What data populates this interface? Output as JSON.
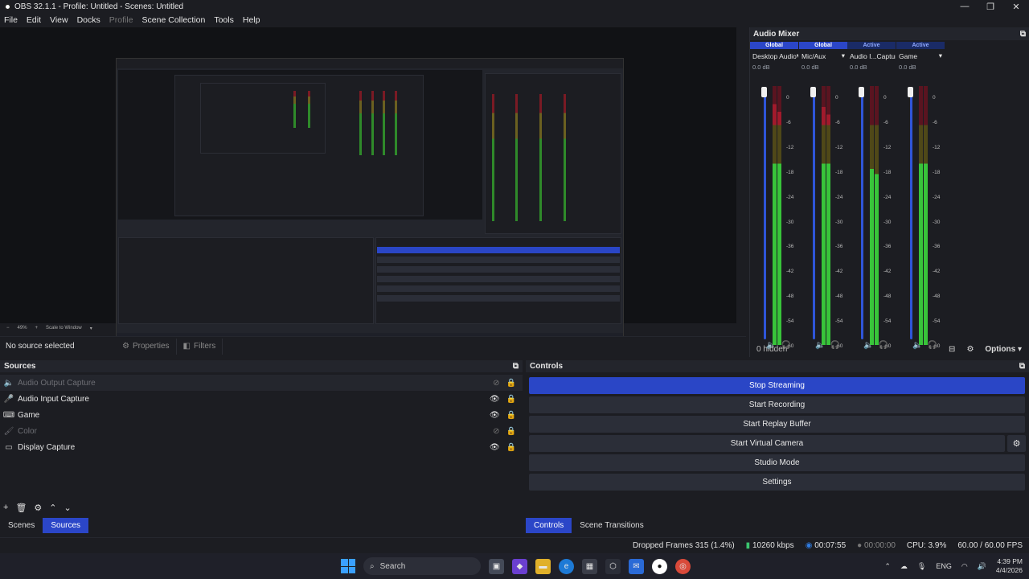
{
  "window": {
    "title": "OBS 32.1.1 - Profile: Untitled - Scenes: Untitled",
    "controls": [
      "—",
      "❐",
      "✕"
    ]
  },
  "menu": {
    "file": "File",
    "edit": "Edit",
    "view": "View",
    "docks": "Docks",
    "profile": "Profile",
    "scene_collection": "Scene Collection",
    "tools": "Tools",
    "help": "Help"
  },
  "preview": {
    "zoom": "49%",
    "scale_label": "Scale to Window"
  },
  "props": {
    "no_source": "No source selected",
    "properties": "Properties",
    "filters": "Filters"
  },
  "mixer": {
    "title": "Audio Mixer",
    "channels": [
      {
        "badge": "Global",
        "badge_type": "global",
        "name": "Desktop Audio",
        "db": "0.0 dB",
        "level": 0.93
      },
      {
        "badge": "Global",
        "badge_type": "global",
        "name": "Mic/Aux",
        "db": "0.0 dB",
        "level": 0.92
      },
      {
        "badge": "Active",
        "badge_type": "active",
        "name": "Audio I...Capture",
        "db": "0.0 dB",
        "level": 0.68
      },
      {
        "badge": "Active",
        "badge_type": "active",
        "name": "Game",
        "db": "0.0 dB",
        "level": 0.72
      }
    ],
    "scale": [
      "0",
      "-6",
      "-12",
      "-18",
      "-24",
      "-30",
      "-36",
      "-42",
      "-48",
      "-54",
      "-60"
    ],
    "hidden": "0 hidden",
    "options": "Options"
  },
  "sources": {
    "title": "Sources",
    "items": [
      {
        "name": "Audio Output Capture",
        "icon": "speaker-icon",
        "glyph": "🔈",
        "visible": false
      },
      {
        "name": "Audio Input Capture",
        "icon": "mic-icon",
        "glyph": "🎤",
        "visible": true
      },
      {
        "name": "Game",
        "icon": "gamepad-icon",
        "glyph": "⌨",
        "visible": true
      },
      {
        "name": "Color",
        "icon": "brush-icon",
        "glyph": "🖌",
        "visible": false
      },
      {
        "name": "Display Capture",
        "icon": "monitor-icon",
        "glyph": "▭",
        "visible": true
      }
    ],
    "tabs": {
      "scenes": "Scenes",
      "sources": "Sources"
    }
  },
  "controls": {
    "title": "Controls",
    "stop_streaming": "Stop Streaming",
    "start_recording": "Start Recording",
    "start_replay": "Start Replay Buffer",
    "start_vcam": "Start Virtual Camera",
    "studio_mode": "Studio Mode",
    "settings": "Settings",
    "tabs": {
      "controls": "Controls",
      "transitions": "Scene Transitions"
    }
  },
  "status": {
    "dropped": "Dropped Frames 315 (1.4%)",
    "bitrate": "10260 kbps",
    "stream_time": "00:07:55",
    "rec_time": "00:00:00",
    "cpu": "CPU: 3.9%",
    "fps": "60.00 / 60.00 FPS"
  },
  "taskbar": {
    "search": "Search",
    "lang": "ENG",
    "time": "4:39 PM",
    "date": "4/4/2026"
  },
  "colors": {
    "accent": "#2a46c6",
    "bg": "#1c1d22",
    "green": "#2fcf6a"
  }
}
